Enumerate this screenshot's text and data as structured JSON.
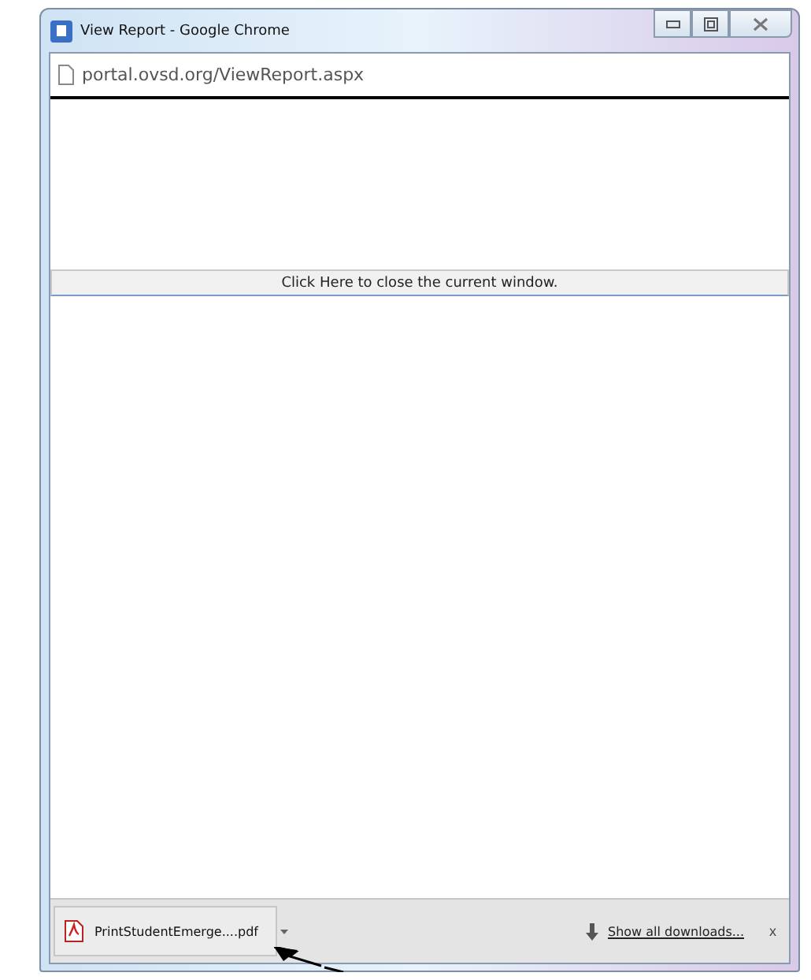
{
  "window": {
    "title": "View Report - Google Chrome"
  },
  "address_bar": {
    "url": "portal.ovsd.org/ViewReport.aspx"
  },
  "page": {
    "close_link": "Click Here to close the current window."
  },
  "download_shelf": {
    "file": "PrintStudentEmerge....pdf",
    "show_all": "Show all downloads...",
    "close": "x"
  }
}
